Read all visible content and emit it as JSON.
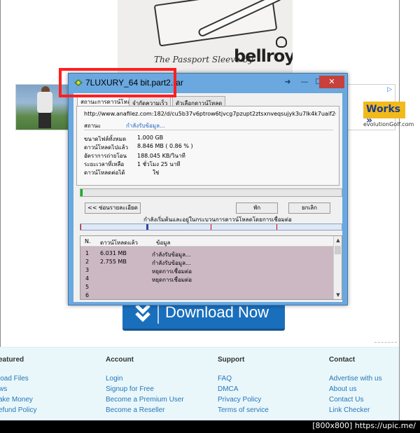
{
  "top_ad": {
    "tagline": "The Passport Sleeve by",
    "brand": "bellroy"
  },
  "golf_ad": {
    "headline": "Works »",
    "subtext": "evolutionGolf.com",
    "badge": "▷"
  },
  "download_button": {
    "label": "Download Now",
    "icon": "download-arrow-icon"
  },
  "idm": {
    "title": "7LUXURY_64 bit.part2.rar",
    "tabs": [
      "สถานะการดาวน์โหลด",
      "จำกัดความเร็ว",
      "ตัวเลือกดาวน์โหลด"
    ],
    "url": "http://www.anafilez.com:182/d/cu5b37v6ptrow6tjvcg7pzupt2ztsxnveqsujyk3u7lk4k7uaif26qw/7LU",
    "status_label": "สถานะ",
    "status_value": "กำลังรับข้อมูล...",
    "info": [
      {
        "label": "ขนาดไฟล์ทั้งหมด",
        "value": "1.000  GB"
      },
      {
        "label": "ดาวน์โหลดไปแล้ว",
        "value": "8.846  MB  ( 0.86 % )"
      },
      {
        "label": "อัตราการถ่ายโอน",
        "value": "188.045  KB/วินาที"
      },
      {
        "label": "ระยะเวลาที่เหลือ",
        "value": "1 ชั่วโมง 25 นาที"
      },
      {
        "label": "ดาวน์โหลดต่อได้",
        "value": "ใช่"
      }
    ],
    "progress_percent": 0.86,
    "buttons": {
      "details": "<< ซ่อนรายละเอียด",
      "pause": "พัก",
      "cancel": "ยกเลิก"
    },
    "hint": "กำลังเริ่มต้นและอยู่ในกระบวนการดาวน์โหลดโดยการเชื่อมต่อ",
    "table_headers": [
      "N.",
      "ดาวน์โหลดแล้ว",
      "ข้อมูล"
    ],
    "rows": [
      {
        "n": "1",
        "downloaded": "6.031  MB",
        "info": "กำลังรับข้อมูล..."
      },
      {
        "n": "2",
        "downloaded": "2.755  MB",
        "info": "กำลังรับข้อมูล..."
      },
      {
        "n": "3",
        "downloaded": "",
        "info": "หยุดการเชื่อมต่อ"
      },
      {
        "n": "4",
        "downloaded": "",
        "info": "หยุดการเชื่อมต่อ"
      },
      {
        "n": "5",
        "downloaded": "",
        "info": ""
      },
      {
        "n": "6",
        "downloaded": "",
        "info": ""
      }
    ]
  },
  "footer": {
    "columns": [
      {
        "title": "eatured",
        "links": [
          "load Files",
          "ws",
          "ake Money",
          "efund Policy"
        ]
      },
      {
        "title": "Account",
        "links": [
          "Login",
          "Signup for Free",
          "Become a Premium User",
          "Become a Reseller"
        ]
      },
      {
        "title": "Support",
        "links": [
          "FAQ",
          "DMCA",
          "Privacy Policy",
          "Terms of service"
        ]
      },
      {
        "title": "Contact",
        "links": [
          "Advertise with us",
          "About us",
          "Contact Us",
          "Link Checker"
        ]
      }
    ]
  },
  "caption": "[800x800] https://upic.me/",
  "colors": {
    "highlight": "#ff1f1f",
    "progress": "#06b025",
    "download_button": "#1a6fbd",
    "link": "#2876b8"
  }
}
